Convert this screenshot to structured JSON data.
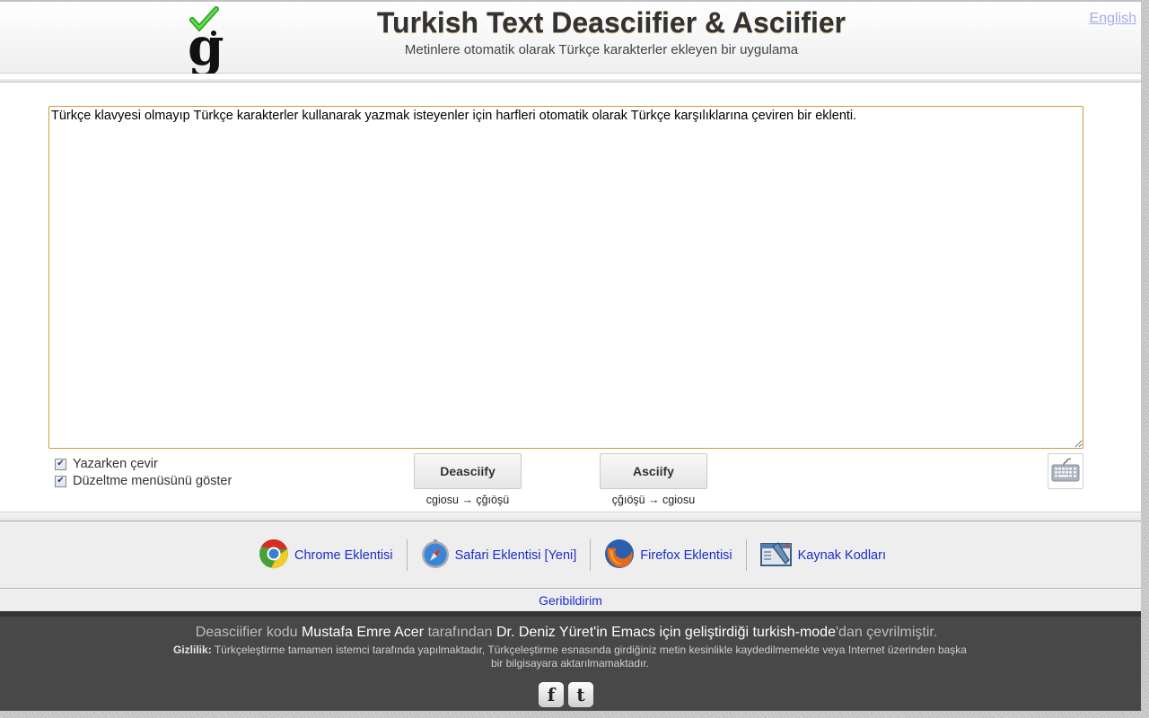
{
  "header": {
    "title": "Turkish Text Deasciifier & Asciifier",
    "subtitle": "Metinlere otomatik olarak Türkçe karakterler ekleyen bir uygulama",
    "language_link": "English",
    "logo_icon": "g-with-checkmark-logo"
  },
  "editor": {
    "value": "Türkçe klavyesi olmayıp Türkçe karakterler kullanarak yazmak isteyenler için harfleri otomatik olarak Türkçe karşılıklarına çeviren bir eklenti."
  },
  "options": [
    {
      "label": "Yazarken çevir",
      "checked": true
    },
    {
      "label": "Düzeltme menüsünü göster",
      "checked": true
    }
  ],
  "actions": {
    "deasciify": {
      "label": "Deasciify",
      "hint": "cgiosu → çğıöşü"
    },
    "asciify": {
      "label": "Asciify",
      "hint": "çğıöşü → cgiosu"
    },
    "keyboard_icon": "keyboard-icon"
  },
  "extensions": [
    {
      "label": "Chrome Eklentisi",
      "icon": "chrome-icon"
    },
    {
      "label": "Safari Eklentisi [Yeni]",
      "icon": "safari-icon"
    },
    {
      "label": "Firefox Eklentisi",
      "icon": "firefox-icon"
    },
    {
      "label": "Kaynak Kodları",
      "icon": "source-code-icon"
    }
  ],
  "feedback": {
    "label": "Geribildirim"
  },
  "footer": {
    "credits": {
      "part1": "Deasciifier kodu ",
      "author": "Mustafa Emre Acer",
      "part2": " tarafından ",
      "origin": "Dr. Deniz Yüret'in Emacs için geliştirdiği turkish-mode",
      "part3": "'dan çevrilmiştir."
    },
    "privacy_label": "Gizlilik:",
    "privacy_text": " Türkçeleştirme tamamen istemci tarafında yapılmaktadır, Türkçeleştirme esnasında girdiğiniz metin kesinlikle kaydedilmemekte veya Internet üzerinden başka bir bilgisayara aktarılmamaktadır.",
    "social": [
      {
        "label": "f",
        "icon": "facebook-icon"
      },
      {
        "label": "t",
        "icon": "twitter-icon"
      }
    ]
  }
}
